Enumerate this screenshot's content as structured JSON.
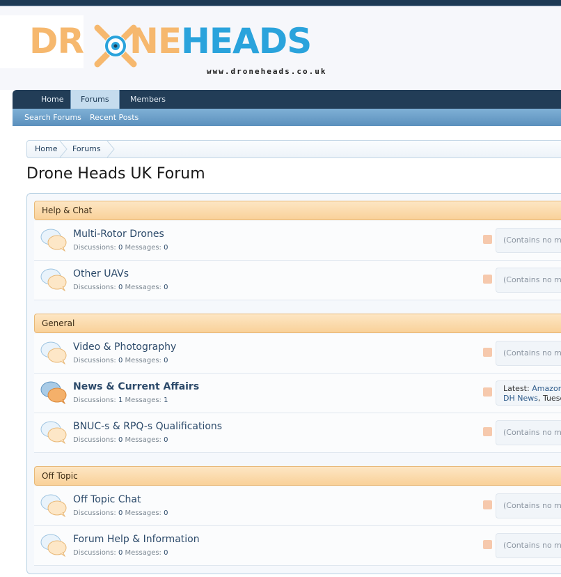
{
  "logo": {
    "part1": "DR",
    "part2": "NE",
    "part3": "HEADS",
    "url": "www.droneheads.co.uk"
  },
  "nav": {
    "tabs": [
      "Home",
      "Forums",
      "Members"
    ],
    "active": "Forums",
    "sub": [
      "Search Forums",
      "Recent Posts"
    ]
  },
  "breadcrumb": [
    "Home",
    "Forums"
  ],
  "page_title": "Drone Heads UK Forum",
  "labels": {
    "discussions": "Discussions:",
    "messages": "Messages:",
    "latest": "Latest:"
  },
  "categories": [
    {
      "title": "Help & Chat",
      "forums": [
        {
          "name": "Multi-Rotor Drones",
          "discussions": "0",
          "messages": "0",
          "last": "(Contains no mes"
        },
        {
          "name": "Other UAVs",
          "discussions": "0",
          "messages": "0",
          "last": "(Contains no mes"
        }
      ]
    },
    {
      "title": "General",
      "forums": [
        {
          "name": "Video & Photography",
          "discussions": "0",
          "messages": "0",
          "last": "(Contains no mes"
        },
        {
          "name": "News & Current Affairs",
          "discussions": "1",
          "messages": "1",
          "latest_title": "Amazon's",
          "latest_user": "DH News",
          "latest_time": "Tuesda"
        },
        {
          "name": "BNUC-s & RPQ-s Qualifications",
          "discussions": "0",
          "messages": "0",
          "last": "(Contains no mes"
        }
      ]
    },
    {
      "title": "Off Topic",
      "forums": [
        {
          "name": "Off Topic Chat",
          "discussions": "0",
          "messages": "0",
          "last": "(Contains no mes"
        },
        {
          "name": "Forum Help & Information",
          "discussions": "0",
          "messages": "0",
          "last": "(Contains no mes"
        }
      ]
    }
  ],
  "colors": {
    "nav": "#223d57",
    "category": "#fbdcae",
    "link": "#2c4a6a"
  }
}
